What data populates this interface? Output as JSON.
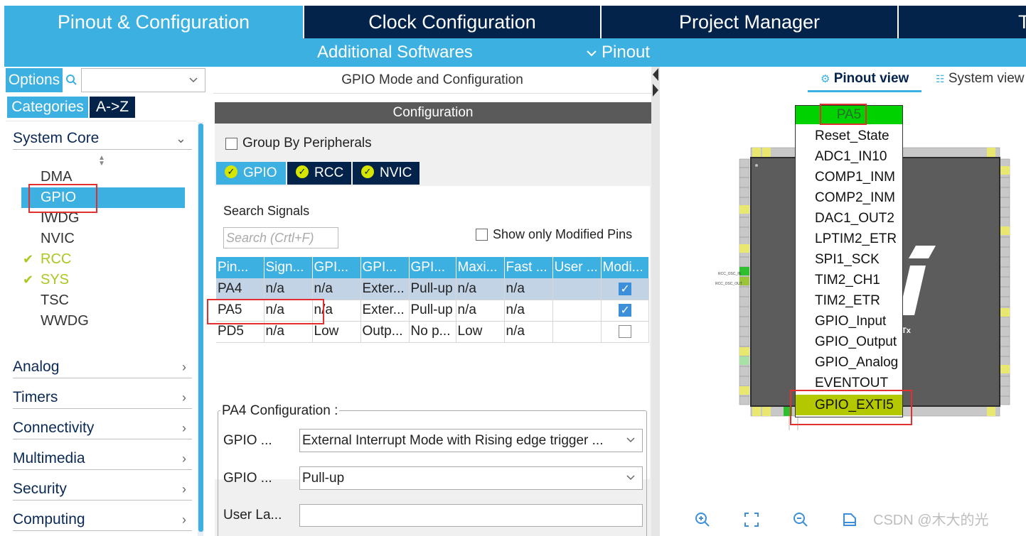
{
  "top_tabs": {
    "pinout": "Pinout & Configuration",
    "clock": "Clock Configuration",
    "project": "Project Manager",
    "tools": "T"
  },
  "subnav": {
    "additional": "Additional Softwares",
    "pinout": "Pinout"
  },
  "left": {
    "options": "Options",
    "search_value": "",
    "categories": "Categories",
    "az": "A->Z",
    "system_core": "System Core",
    "items": [
      "DMA",
      "GPIO",
      "IWDG",
      "NVIC",
      "RCC",
      "SYS",
      "TSC",
      "WWDG"
    ],
    "sections": [
      "Analog",
      "Timers",
      "Connectivity",
      "Multimedia",
      "Security",
      "Computing"
    ]
  },
  "middle": {
    "title": "GPIO Mode and Configuration",
    "config_bar": "Configuration",
    "group_by": "Group By Peripherals",
    "periph_tabs": [
      "GPIO",
      "RCC",
      "NVIC"
    ],
    "search_signals": "Search Signals",
    "search_placeholder": "Search (Crtl+F)",
    "show_modified": "Show only Modified Pins",
    "columns": [
      "Pin...",
      "Sign...",
      "GPI...",
      "GPI...",
      "GPI...",
      "Maxi...",
      "Fast ...",
      "User ...",
      "Modi..."
    ],
    "rows": [
      {
        "pin": "PA4",
        "signal": "n/a",
        "gpio_out": "n/a",
        "mode": "Exter...",
        "pull": "Pull-up",
        "speed": "n/a",
        "fast": "n/a",
        "user": "",
        "modified": true
      },
      {
        "pin": "PA5",
        "signal": "n/a",
        "gpio_out": "n/a",
        "mode": "Exter...",
        "pull": "Pull-up",
        "speed": "n/a",
        "fast": "n/a",
        "user": "",
        "modified": true
      },
      {
        "pin": "PD5",
        "signal": "n/a",
        "gpio_out": "Low",
        "mode": "Outp...",
        "pull": "No p...",
        "speed": "Low",
        "fast": "n/a",
        "user": "",
        "modified": false
      }
    ],
    "pa4_config": "PA4 Configuration :",
    "field1_label": "GPIO ...",
    "field1_value": "External Interrupt Mode with Rising edge trigger ...",
    "field2_label": "GPIO ...",
    "field2_value": "Pull-up",
    "field3_label": "User La...",
    "field3_value": ""
  },
  "right": {
    "pinout_view": "Pinout view",
    "system_view": "System view",
    "popup_title": "PA5",
    "popup_items": [
      "Reset_State",
      "ADC1_IN10",
      "COMP1_INM",
      "COMP2_INM",
      "DAC1_OUT2",
      "LPTIM2_ETR",
      "SPI1_SCK",
      "TIM2_CH1",
      "TIM2_ETR",
      "GPIO_Input",
      "GPIO_Output",
      "GPIO_Analog",
      "EVENTOUT",
      "GPIO_EXTI5"
    ],
    "selected_item": "GPIO_EXTI5",
    "chip_suffix": "Tx",
    "left_pin_labels": [
      "RCC_OSC_IN",
      "RCC_OSC_OUT"
    ],
    "watermark": "CSDN @木大的光"
  },
  "colors": {
    "brand_blue": "#3cb0e1",
    "navy": "#03234b",
    "green_pin": "#00d200",
    "selected_lime": "#b4c800",
    "annotation_red": "#e03030"
  }
}
